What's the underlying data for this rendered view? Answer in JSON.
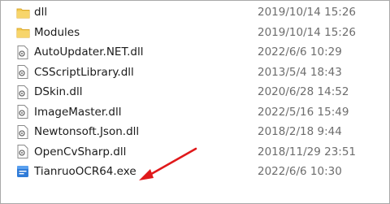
{
  "files": [
    {
      "name": "dll",
      "date": "2019/10/14 15:26",
      "icon": "folder-icon",
      "type": "folder"
    },
    {
      "name": "Modules",
      "date": "2019/10/14 15:26",
      "icon": "folder-icon",
      "type": "folder"
    },
    {
      "name": "AutoUpdater.NET.dll",
      "date": "2022/6/6 10:29",
      "icon": "dll-file-icon",
      "type": "dll"
    },
    {
      "name": "CSScriptLibrary.dll",
      "date": "2013/5/4 18:43",
      "icon": "dll-file-icon",
      "type": "dll"
    },
    {
      "name": "DSkin.dll",
      "date": "2020/6/28 14:52",
      "icon": "dll-file-icon",
      "type": "dll"
    },
    {
      "name": "ImageMaster.dll",
      "date": "2022/5/16 15:49",
      "icon": "dll-file-icon",
      "type": "dll"
    },
    {
      "name": "Newtonsoft.Json.dll",
      "date": "2018/2/18 9:44",
      "icon": "dll-file-icon",
      "type": "dll"
    },
    {
      "name": "OpenCvSharp.dll",
      "date": "2018/11/29 23:51",
      "icon": "dll-file-icon",
      "type": "dll"
    },
    {
      "name": "TianruoOCR64.exe",
      "date": "2022/6/6 10:30",
      "icon": "exe-app-icon",
      "type": "exe"
    }
  ],
  "colors": {
    "folder": "#f2c94c",
    "folder_dark": "#dca92e",
    "arrow": "#e0191b",
    "date_text": "#6d6d6d"
  }
}
